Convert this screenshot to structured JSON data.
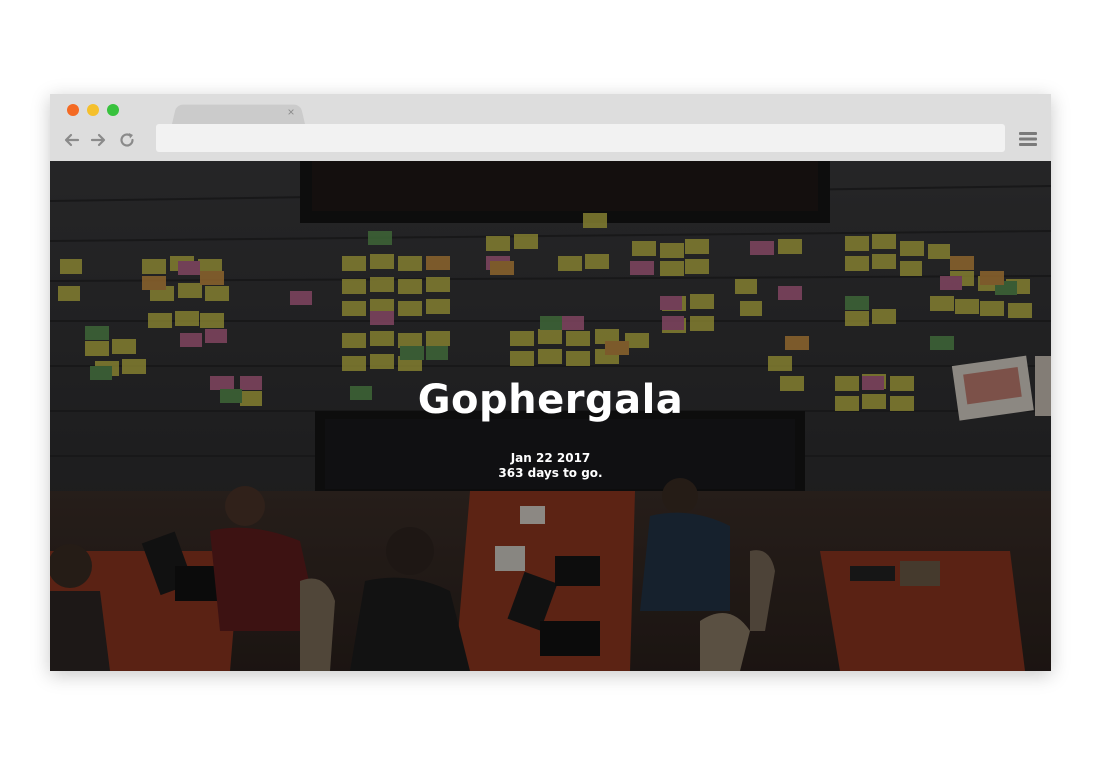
{
  "window": {
    "controls": [
      "close",
      "minimize",
      "maximize"
    ],
    "colors": {
      "close": "#f46a23",
      "minimize": "#f5c02c",
      "maximize": "#38c23d"
    }
  },
  "tab": {
    "close_glyph": "×"
  },
  "toolbar": {
    "back_icon": "arrow-left-icon",
    "forward_icon": "arrow-right-icon",
    "reload_icon": "reload-icon",
    "address_value": "",
    "menu_icon": "hamburger-menu-icon"
  },
  "hero": {
    "title": "Gophergala",
    "date": "Jan 22 2017",
    "countdown": "363 days to go.",
    "background": "photo of hackathon room with sticky notes on wall and people at laptops"
  }
}
